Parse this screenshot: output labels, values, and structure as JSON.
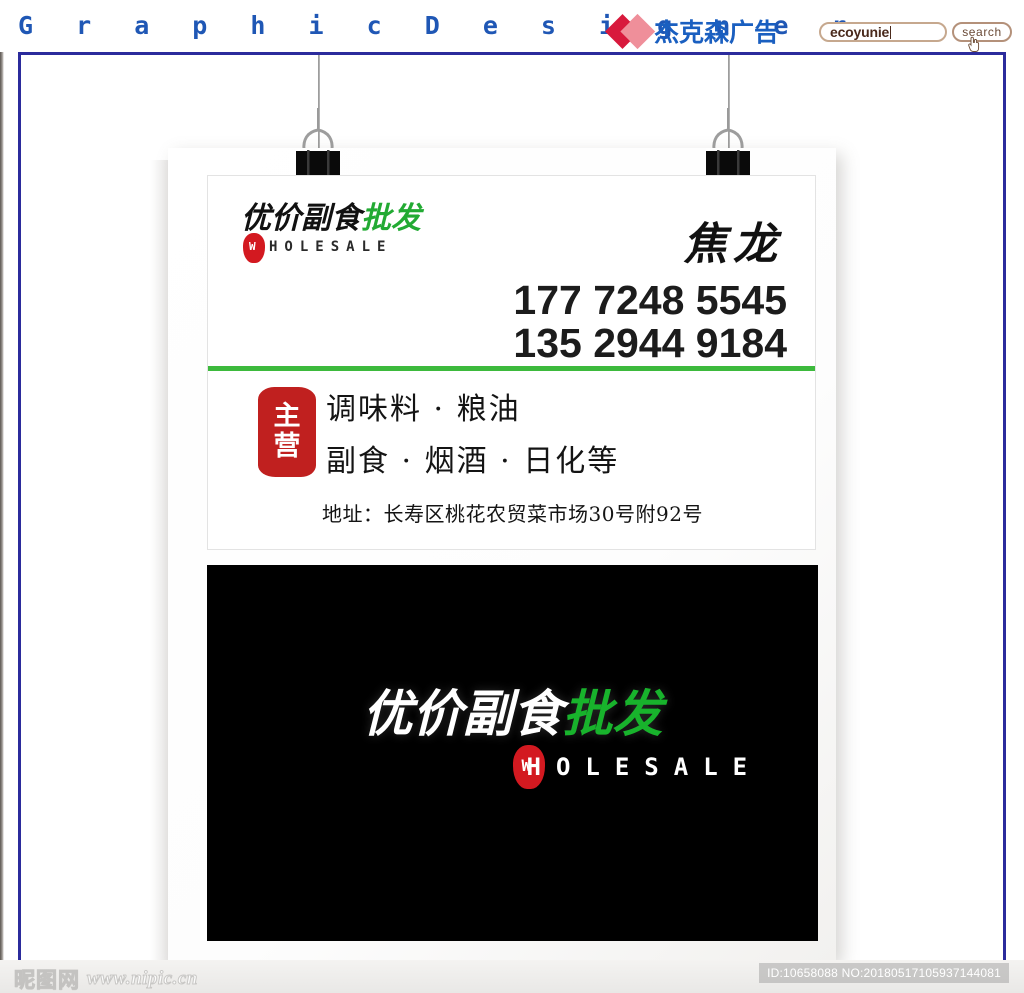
{
  "header": {
    "title": "G r a p h i c    D e s i g n e r",
    "logo_icon": "diamond-logo-icon",
    "logo_text": "杰克森广告",
    "search": {
      "value": "ecoyunie",
      "placeholder": "ecoyunie",
      "button_label": "search",
      "cursor_icon": "hand-cursor-icon"
    }
  },
  "artboard": {
    "clips": [
      {
        "name": "binder-clip-left",
        "icon": "binder-clip-icon"
      },
      {
        "name": "binder-clip-right",
        "icon": "binder-clip-icon"
      }
    ],
    "business_card": {
      "brand_logo": {
        "cn_black": "优价副食",
        "cn_green": "批发",
        "seal_letter": "W",
        "latin": "HOLESALE"
      },
      "owner_name": "焦龙",
      "phones": [
        "177 7248 5545",
        "135 2944 9184"
      ],
      "divider_color": "#3dba3d",
      "seal_text_line1": "主",
      "seal_text_line2": "营",
      "services": [
        "调味料 · 粮油",
        "副食 · 烟酒 · 日化等"
      ],
      "address": "地址：长寿区桃花农贸菜市场30号附92号"
    },
    "black_panel": {
      "cn_white": "优价副食",
      "cn_green": "批发",
      "seal_letter": "W",
      "latin": "HOLESALE",
      "background_color": "#000000"
    }
  },
  "footer": {
    "watermark_cn": "昵图网",
    "watermark_url": "www.nipic.cn",
    "id_text": "ID:10658088 NO:20180517105937144081"
  }
}
